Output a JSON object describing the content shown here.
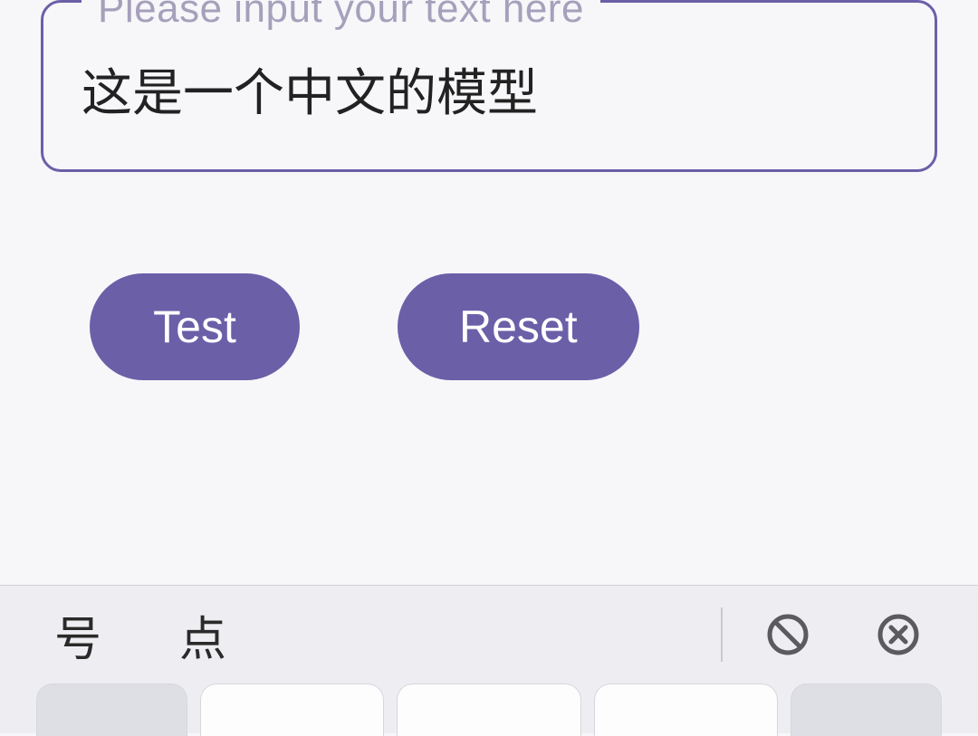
{
  "input": {
    "legend": "Please input your text here",
    "value": "这是一个中文的模型"
  },
  "buttons": {
    "test": "Test",
    "reset": "Reset"
  },
  "keyboard": {
    "suggestions": [
      "号",
      "点"
    ]
  }
}
